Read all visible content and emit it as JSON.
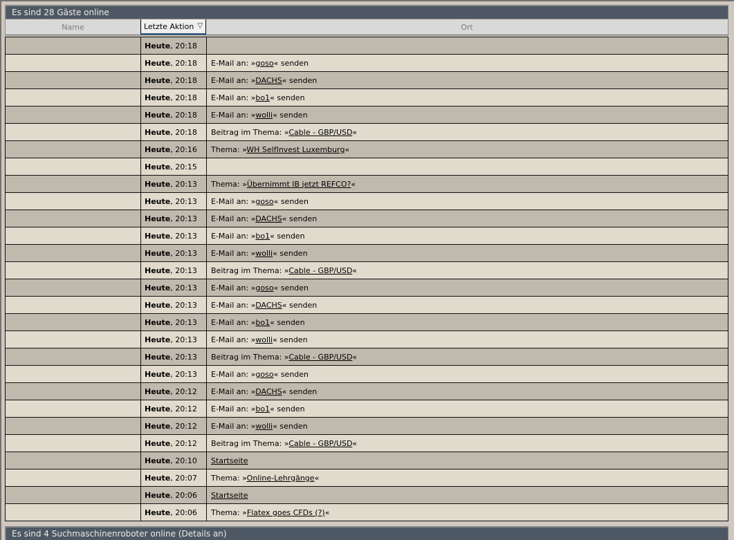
{
  "guests_panel": {
    "title": "Es sind 28 Gäste online",
    "columns": {
      "name": "Name",
      "last_action": "Letzte Aktion",
      "location": "Ort"
    },
    "sort_icon": "▽",
    "day_label": "Heute",
    "rows": [
      {
        "time": "20:18",
        "prefix": "",
        "link": "",
        "suffix": ""
      },
      {
        "time": "20:18",
        "prefix": "E-Mail an: »",
        "link": "goso",
        "suffix": "« senden"
      },
      {
        "time": "20:18",
        "prefix": "E-Mail an: »",
        "link": "DACHS",
        "suffix": "« senden"
      },
      {
        "time": "20:18",
        "prefix": "E-Mail an: »",
        "link": "bo1",
        "suffix": "« senden"
      },
      {
        "time": "20:18",
        "prefix": "E-Mail an: »",
        "link": "wolli",
        "suffix": "« senden"
      },
      {
        "time": "20:18",
        "prefix": "Beitrag im Thema: »",
        "link": "Cable - GBP/USD",
        "suffix": "«"
      },
      {
        "time": "20:16",
        "prefix": "Thema: »",
        "link": "WH SelfInvest Luxemburg",
        "suffix": "«"
      },
      {
        "time": "20:15",
        "prefix": "",
        "link": "",
        "suffix": ""
      },
      {
        "time": "20:13",
        "prefix": "Thema: »",
        "link": "Übernimmt IB jetzt REFCO?",
        "suffix": "«"
      },
      {
        "time": "20:13",
        "prefix": "E-Mail an: »",
        "link": "goso",
        "suffix": "« senden"
      },
      {
        "time": "20:13",
        "prefix": "E-Mail an: »",
        "link": "DACHS",
        "suffix": "« senden"
      },
      {
        "time": "20:13",
        "prefix": "E-Mail an: »",
        "link": "bo1",
        "suffix": "« senden"
      },
      {
        "time": "20:13",
        "prefix": "E-Mail an: »",
        "link": "wolli",
        "suffix": "« senden"
      },
      {
        "time": "20:13",
        "prefix": "Beitrag im Thema: »",
        "link": "Cable - GBP/USD",
        "suffix": "«"
      },
      {
        "time": "20:13",
        "prefix": "E-Mail an: »",
        "link": "goso",
        "suffix": "« senden"
      },
      {
        "time": "20:13",
        "prefix": "E-Mail an: »",
        "link": "DACHS",
        "suffix": "« senden"
      },
      {
        "time": "20:13",
        "prefix": "E-Mail an: »",
        "link": "bo1",
        "suffix": "« senden"
      },
      {
        "time": "20:13",
        "prefix": "E-Mail an: »",
        "link": "wolli",
        "suffix": "« senden"
      },
      {
        "time": "20:13",
        "prefix": "Beitrag im Thema: »",
        "link": "Cable - GBP/USD",
        "suffix": "«"
      },
      {
        "time": "20:13",
        "prefix": "E-Mail an: »",
        "link": "goso",
        "suffix": "« senden"
      },
      {
        "time": "20:12",
        "prefix": "E-Mail an: »",
        "link": "DACHS",
        "suffix": "« senden"
      },
      {
        "time": "20:12",
        "prefix": "E-Mail an: »",
        "link": "bo1",
        "suffix": "« senden"
      },
      {
        "time": "20:12",
        "prefix": "E-Mail an: »",
        "link": "wolli",
        "suffix": "« senden"
      },
      {
        "time": "20:12",
        "prefix": "Beitrag im Thema: »",
        "link": "Cable - GBP/USD",
        "suffix": "«"
      },
      {
        "time": "20:10",
        "prefix": "",
        "link": "Startseite",
        "suffix": ""
      },
      {
        "time": "20:07",
        "prefix": "Thema: »",
        "link": "Online-Lehrgänge",
        "suffix": "«"
      },
      {
        "time": "20:06",
        "prefix": "",
        "link": "Startseite",
        "suffix": ""
      },
      {
        "time": "20:06",
        "prefix": "Thema: »",
        "link": "Flatex goes CFDs (?)",
        "suffix": "«"
      }
    ]
  },
  "robots_panel": {
    "title": "Es sind 4 Suchmaschinenroboter online",
    "details_link": "(Details an)"
  },
  "colors": {
    "title_bar_bg": "#4d5864",
    "row_dark": "#c0b9ad",
    "row_light": "#e0dbcd",
    "header_bg": "#d9d9d9",
    "sorted_header_bg": "#efefef",
    "sort_underline": "#30608f",
    "page_bg": "#cfc8c0"
  }
}
